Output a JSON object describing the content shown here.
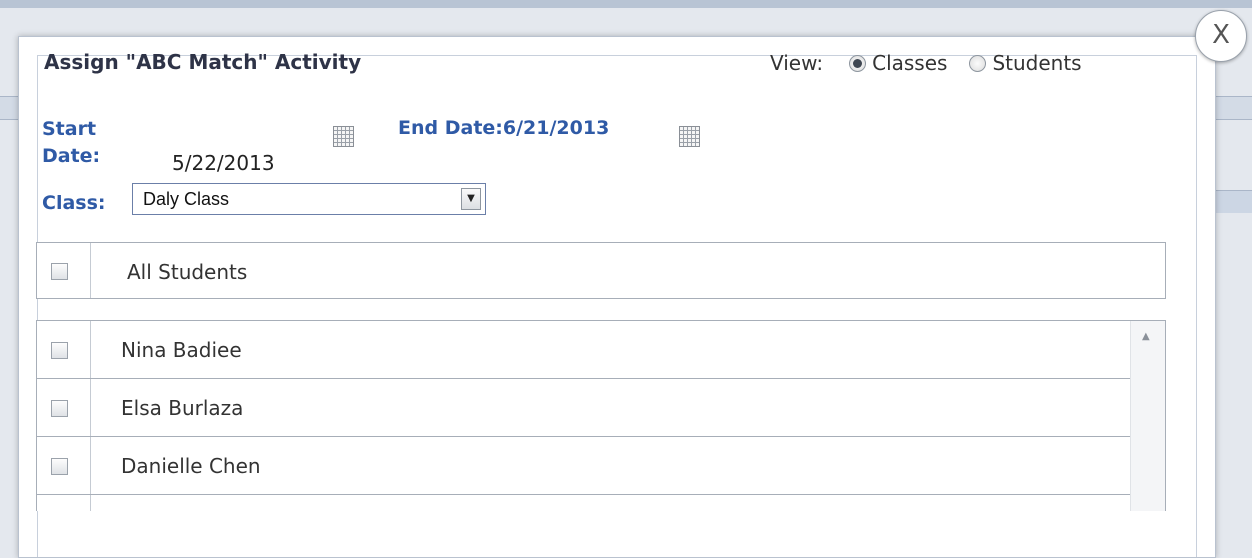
{
  "dialog": {
    "title": "Assign \"ABC Match\" Activity",
    "close_label": "X"
  },
  "view": {
    "label": "View:",
    "options": [
      "Classes",
      "Students"
    ],
    "selected": "Classes"
  },
  "dates": {
    "start_label_line1": "Start",
    "start_label_line2": "Date:",
    "start_value": "5/22/2013",
    "end_label": "End Date:",
    "end_value": "6/21/2013"
  },
  "class_field": {
    "label": "Class:",
    "value": "Daly Class"
  },
  "students": {
    "all_label": "All Students",
    "items": [
      "Nina Badiee",
      "Elsa Burlaza",
      "Danielle Chen"
    ]
  },
  "icons": {
    "calendar": "calendar-icon",
    "close": "close-icon",
    "dropdown": "chevron-down-icon",
    "scroll_up": "scroll-up-arrow-icon"
  },
  "colors": {
    "label_blue": "#2f5aa6",
    "title_text": "#2e3347"
  }
}
